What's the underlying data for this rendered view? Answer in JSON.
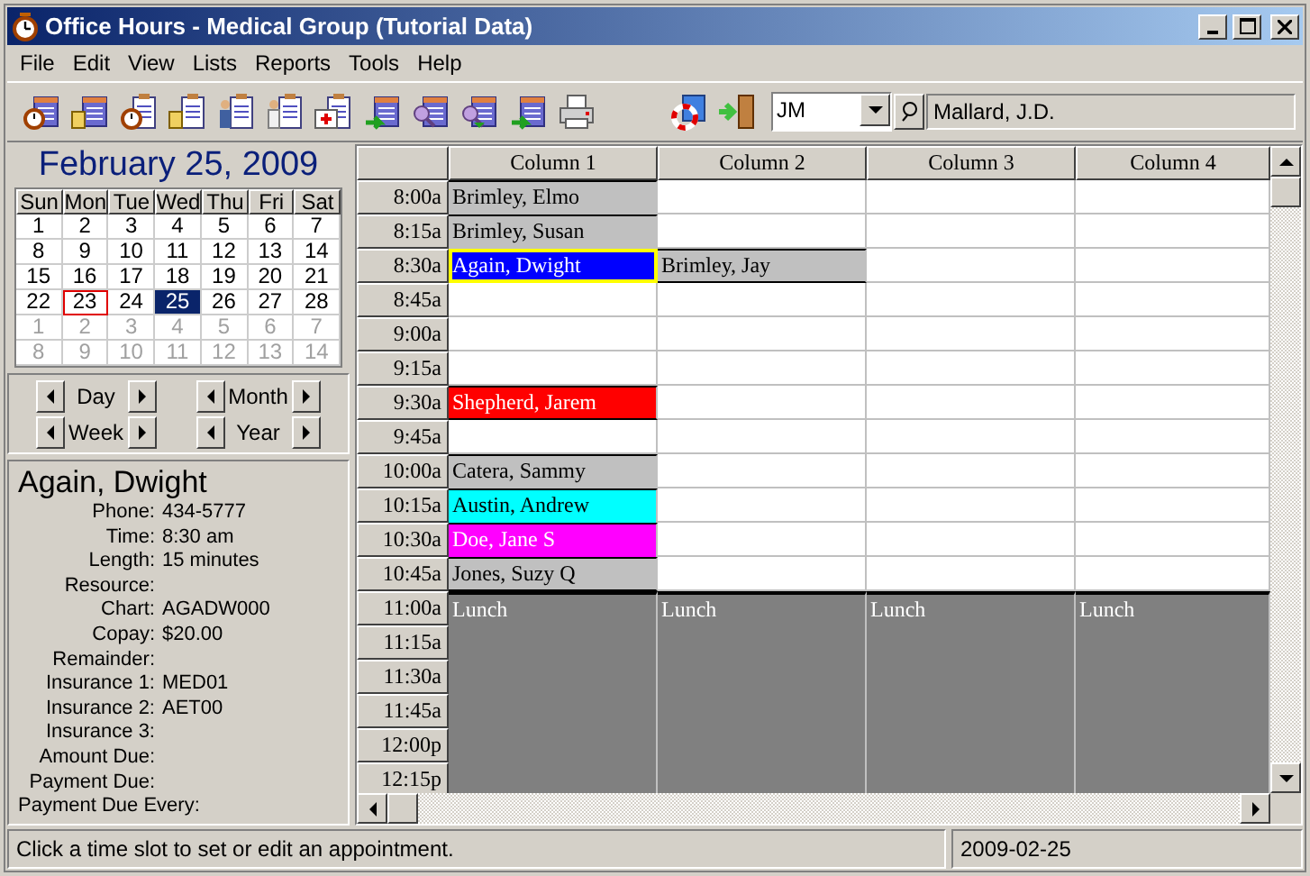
{
  "window": {
    "title": "Office Hours - Medical Group (Tutorial Data)"
  },
  "menu": [
    "File",
    "Edit",
    "View",
    "Lists",
    "Reports",
    "Tools",
    "Help"
  ],
  "toolbar": {
    "user_code": "JM",
    "user_name": "Mallard, J.D."
  },
  "calendar": {
    "title": "February 25, 2009",
    "weekdays": [
      "Sun",
      "Mon",
      "Tue",
      "Wed",
      "Thu",
      "Fri",
      "Sat"
    ],
    "weeks": [
      [
        {
          "label": "1",
          "muted": false,
          "selected": false,
          "marked": false
        },
        {
          "label": "2",
          "muted": false,
          "selected": false,
          "marked": false
        },
        {
          "label": "3",
          "muted": false,
          "selected": false,
          "marked": false
        },
        {
          "label": "4",
          "muted": false,
          "selected": false,
          "marked": false
        },
        {
          "label": "5",
          "muted": false,
          "selected": false,
          "marked": false
        },
        {
          "label": "6",
          "muted": false,
          "selected": false,
          "marked": false
        },
        {
          "label": "7",
          "muted": false,
          "selected": false,
          "marked": false
        }
      ],
      [
        {
          "label": "8",
          "muted": false,
          "selected": false,
          "marked": false
        },
        {
          "label": "9",
          "muted": false,
          "selected": false,
          "marked": false
        },
        {
          "label": "10",
          "muted": false,
          "selected": false,
          "marked": false
        },
        {
          "label": "11",
          "muted": false,
          "selected": false,
          "marked": false
        },
        {
          "label": "12",
          "muted": false,
          "selected": false,
          "marked": false
        },
        {
          "label": "13",
          "muted": false,
          "selected": false,
          "marked": false
        },
        {
          "label": "14",
          "muted": false,
          "selected": false,
          "marked": false
        }
      ],
      [
        {
          "label": "15",
          "muted": false,
          "selected": false,
          "marked": false
        },
        {
          "label": "16",
          "muted": false,
          "selected": false,
          "marked": false
        },
        {
          "label": "17",
          "muted": false,
          "selected": false,
          "marked": false
        },
        {
          "label": "18",
          "muted": false,
          "selected": false,
          "marked": false
        },
        {
          "label": "19",
          "muted": false,
          "selected": false,
          "marked": false
        },
        {
          "label": "20",
          "muted": false,
          "selected": false,
          "marked": false
        },
        {
          "label": "21",
          "muted": false,
          "selected": false,
          "marked": false
        }
      ],
      [
        {
          "label": "22",
          "muted": false,
          "selected": false,
          "marked": false
        },
        {
          "label": "23",
          "muted": false,
          "selected": false,
          "marked": true
        },
        {
          "label": "24",
          "muted": false,
          "selected": false,
          "marked": false
        },
        {
          "label": "25",
          "muted": false,
          "selected": true,
          "marked": false
        },
        {
          "label": "26",
          "muted": false,
          "selected": false,
          "marked": false
        },
        {
          "label": "27",
          "muted": false,
          "selected": false,
          "marked": false
        },
        {
          "label": "28",
          "muted": false,
          "selected": false,
          "marked": false
        }
      ],
      [
        {
          "label": "1",
          "muted": true,
          "selected": false,
          "marked": false
        },
        {
          "label": "2",
          "muted": true,
          "selected": false,
          "marked": false
        },
        {
          "label": "3",
          "muted": true,
          "selected": false,
          "marked": false
        },
        {
          "label": "4",
          "muted": true,
          "selected": false,
          "marked": false
        },
        {
          "label": "5",
          "muted": true,
          "selected": false,
          "marked": false
        },
        {
          "label": "6",
          "muted": true,
          "selected": false,
          "marked": false
        },
        {
          "label": "7",
          "muted": true,
          "selected": false,
          "marked": false
        }
      ],
      [
        {
          "label": "8",
          "muted": true,
          "selected": false,
          "marked": false
        },
        {
          "label": "9",
          "muted": true,
          "selected": false,
          "marked": false
        },
        {
          "label": "10",
          "muted": true,
          "selected": false,
          "marked": false
        },
        {
          "label": "11",
          "muted": true,
          "selected": false,
          "marked": false
        },
        {
          "label": "12",
          "muted": true,
          "selected": false,
          "marked": false
        },
        {
          "label": "13",
          "muted": true,
          "selected": false,
          "marked": false
        },
        {
          "label": "14",
          "muted": true,
          "selected": false,
          "marked": false
        }
      ]
    ]
  },
  "navigation": [
    [
      "Day",
      "Week"
    ],
    [
      "Month",
      "Year"
    ]
  ],
  "details": {
    "name": "Again, Dwight",
    "fields": [
      {
        "label": "Phone:",
        "value": "434-5777"
      },
      {
        "label": "Time:",
        "value": "8:30 am"
      },
      {
        "label": "Length:",
        "value": "15 minutes"
      },
      {
        "label": "Resource:"
      },
      {
        "label": "Chart:",
        "value": "AGADW000"
      },
      {
        "label": "Copay:",
        "value": "$20.00"
      },
      {
        "label": "Remainder:"
      },
      {
        "label": "Insurance 1:",
        "value": "MED01"
      },
      {
        "label": "Insurance 2:",
        "value": "AET00"
      },
      {
        "label": "Insurance 3:"
      },
      {
        "label": "Amount Due:"
      },
      {
        "label": "Payment Due:"
      },
      {
        "label": "Payment Due Every:"
      }
    ]
  },
  "schedule": {
    "columns": [
      "Column 1",
      "Column 2",
      "Column 3",
      "Column 4"
    ],
    "rows": [
      {
        "time": "8:00a",
        "cells": [
          {
            "kind": "appointment",
            "text": "Brimley, Elmo",
            "color": "#c0c0c0",
            "selected": false
          },
          {
            "kind": "empty"
          },
          {
            "kind": "empty"
          },
          {
            "kind": "empty"
          }
        ]
      },
      {
        "time": "8:15a",
        "cells": [
          {
            "kind": "appointment",
            "text": "Brimley, Susan",
            "color": "#c0c0c0",
            "selected": false
          },
          {
            "kind": "empty"
          },
          {
            "kind": "empty"
          },
          {
            "kind": "empty"
          }
        ]
      },
      {
        "time": "8:30a",
        "cells": [
          {
            "kind": "appointment",
            "text": "Again, Dwight",
            "color": "#0000ff",
            "selected": true
          },
          {
            "kind": "appointment",
            "text": "Brimley, Jay",
            "color": "#c0c0c0",
            "selected": false
          },
          {
            "kind": "empty"
          },
          {
            "kind": "empty"
          }
        ]
      },
      {
        "time": "8:45a",
        "cells": [
          {
            "kind": "empty"
          },
          {
            "kind": "empty"
          },
          {
            "kind": "empty"
          },
          {
            "kind": "empty"
          }
        ]
      },
      {
        "time": "9:00a",
        "cells": [
          {
            "kind": "empty"
          },
          {
            "kind": "empty"
          },
          {
            "kind": "empty"
          },
          {
            "kind": "empty"
          }
        ]
      },
      {
        "time": "9:15a",
        "cells": [
          {
            "kind": "empty"
          },
          {
            "kind": "empty"
          },
          {
            "kind": "empty"
          },
          {
            "kind": "empty"
          }
        ]
      },
      {
        "time": "9:30a",
        "cells": [
          {
            "kind": "appointment",
            "text": "Shepherd, Jarem",
            "color": "#ff0000",
            "selected": false
          },
          {
            "kind": "empty"
          },
          {
            "kind": "empty"
          },
          {
            "kind": "empty"
          }
        ]
      },
      {
        "time": "9:45a",
        "cells": [
          {
            "kind": "empty"
          },
          {
            "kind": "empty"
          },
          {
            "kind": "empty"
          },
          {
            "kind": "empty"
          }
        ]
      },
      {
        "time": "10:00a",
        "cells": [
          {
            "kind": "appointment",
            "text": "Catera, Sammy",
            "color": "#c0c0c0",
            "selected": false
          },
          {
            "kind": "empty"
          },
          {
            "kind": "empty"
          },
          {
            "kind": "empty"
          }
        ]
      },
      {
        "time": "10:15a",
        "cells": [
          {
            "kind": "appointment",
            "text": "Austin, Andrew",
            "color": "#00ffff",
            "selected": false
          },
          {
            "kind": "empty"
          },
          {
            "kind": "empty"
          },
          {
            "kind": "empty"
          }
        ]
      },
      {
        "time": "10:30a",
        "cells": [
          {
            "kind": "appointment",
            "text": "Doe, Jane S",
            "color": "#ff00ff",
            "selected": false
          },
          {
            "kind": "empty"
          },
          {
            "kind": "empty"
          },
          {
            "kind": "empty"
          }
        ]
      },
      {
        "time": "10:45a",
        "cells": [
          {
            "kind": "appointment",
            "text": "Jones, Suzy Q",
            "color": "#c0c0c0",
            "selected": false
          },
          {
            "kind": "empty"
          },
          {
            "kind": "empty"
          },
          {
            "kind": "empty"
          }
        ]
      },
      {
        "time": "11:00a",
        "cells": [
          {
            "kind": "lunch",
            "text": "Lunch"
          },
          {
            "kind": "lunch",
            "text": "Lunch"
          },
          {
            "kind": "lunch",
            "text": "Lunch"
          },
          {
            "kind": "lunch",
            "text": "Lunch"
          }
        ]
      },
      {
        "time": "11:15a",
        "cells": [
          {
            "kind": "lunch"
          },
          {
            "kind": "lunch"
          },
          {
            "kind": "lunch"
          },
          {
            "kind": "lunch"
          }
        ]
      },
      {
        "time": "11:30a",
        "cells": [
          {
            "kind": "lunch"
          },
          {
            "kind": "lunch"
          },
          {
            "kind": "lunch"
          },
          {
            "kind": "lunch"
          }
        ]
      },
      {
        "time": "11:45a",
        "cells": [
          {
            "kind": "lunch"
          },
          {
            "kind": "lunch"
          },
          {
            "kind": "lunch"
          },
          {
            "kind": "lunch"
          }
        ]
      },
      {
        "time": "12:00p",
        "cells": [
          {
            "kind": "lunch"
          },
          {
            "kind": "lunch"
          },
          {
            "kind": "lunch"
          },
          {
            "kind": "lunch"
          }
        ]
      },
      {
        "time": "12:15p",
        "cells": [
          {
            "kind": "lunch"
          },
          {
            "kind": "lunch"
          },
          {
            "kind": "lunch"
          },
          {
            "kind": "lunch"
          }
        ]
      }
    ]
  },
  "status_bar": {
    "message": "Click a time slot to set or edit an appointment.",
    "date": "2009-02-25"
  }
}
